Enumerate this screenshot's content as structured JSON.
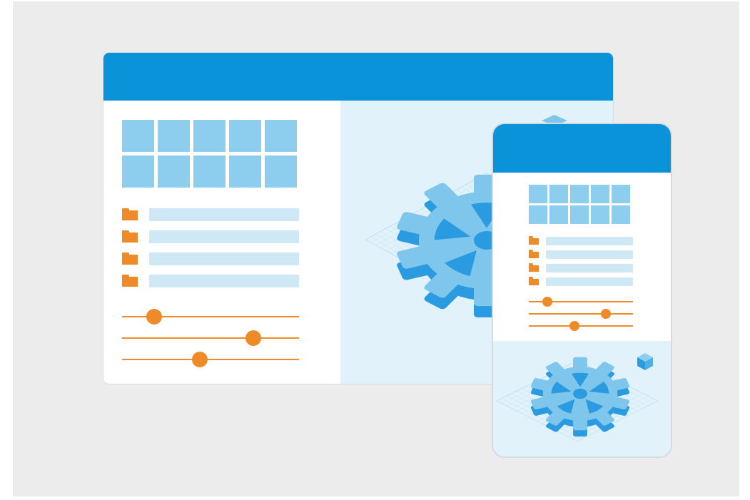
{
  "colors": {
    "background": "#ececec",
    "header": "#0a93d8",
    "tile": "#8dcdee",
    "accent_orange": "#ee8a27",
    "list_bar": "#cfe8f6",
    "illustration_bg": "#e2f2fb",
    "gear_top": "#7fc6ec",
    "gear_side": "#2a9be0"
  },
  "desktop": {
    "tiles": 10,
    "list_items": 4,
    "sliders": [
      0.18,
      0.74,
      0.44
    ]
  },
  "mobile": {
    "tiles": 10,
    "list_items": 4,
    "sliders": [
      0.18,
      0.74,
      0.44
    ]
  },
  "icons": [
    "folder-icon",
    "gear-icon",
    "cube-icon",
    "grid-plane"
  ]
}
